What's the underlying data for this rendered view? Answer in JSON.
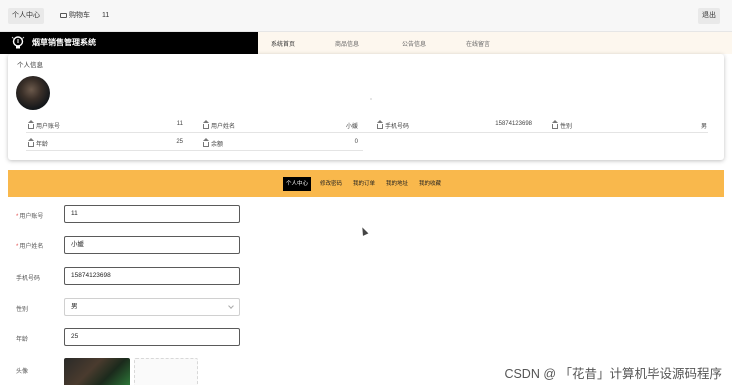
{
  "topbar": {
    "personal_center": "个人中心",
    "cart_label": "购物车",
    "cart_count": "11",
    "logout": "退出"
  },
  "brand": {
    "title": "烟草销售管理系统",
    "logo_icon": "lightbulb-icon"
  },
  "nav": {
    "links": [
      "系统首页",
      "商品信息",
      "公告信息",
      "在线留言"
    ]
  },
  "profile": {
    "section_title": "个人信息",
    "fields": [
      {
        "label": "用户账号",
        "value": "11"
      },
      {
        "label": "用户姓名",
        "value": "小媛"
      },
      {
        "label": "手机号码",
        "value": "15874123698"
      },
      {
        "label": "性别",
        "value": "男"
      },
      {
        "label": "年龄",
        "value": "25"
      },
      {
        "label": "余额",
        "value": "0"
      }
    ]
  },
  "tabs": {
    "items": [
      "个人中心",
      "修改密码",
      "我的订单",
      "我的地址",
      "我的收藏"
    ],
    "active": "个人中心"
  },
  "form": {
    "required_mark": "*",
    "account": {
      "label": "用户账号",
      "value": "11"
    },
    "name": {
      "label": "用户姓名",
      "value": "小媛"
    },
    "phone": {
      "label": "手机号码",
      "value": "15874123698"
    },
    "gender": {
      "label": "性别",
      "value": "男"
    },
    "age": {
      "label": "年龄",
      "value": "25"
    },
    "avatar": {
      "label": "头像"
    }
  },
  "watermark": "CSDN @ 「花昔」计算机毕设源码程序",
  "colors": {
    "brand_bg": "#000000",
    "tab_bar": "#f9b84c",
    "nav_bg": "#fdf7ee",
    "required": "#e34c4c"
  }
}
